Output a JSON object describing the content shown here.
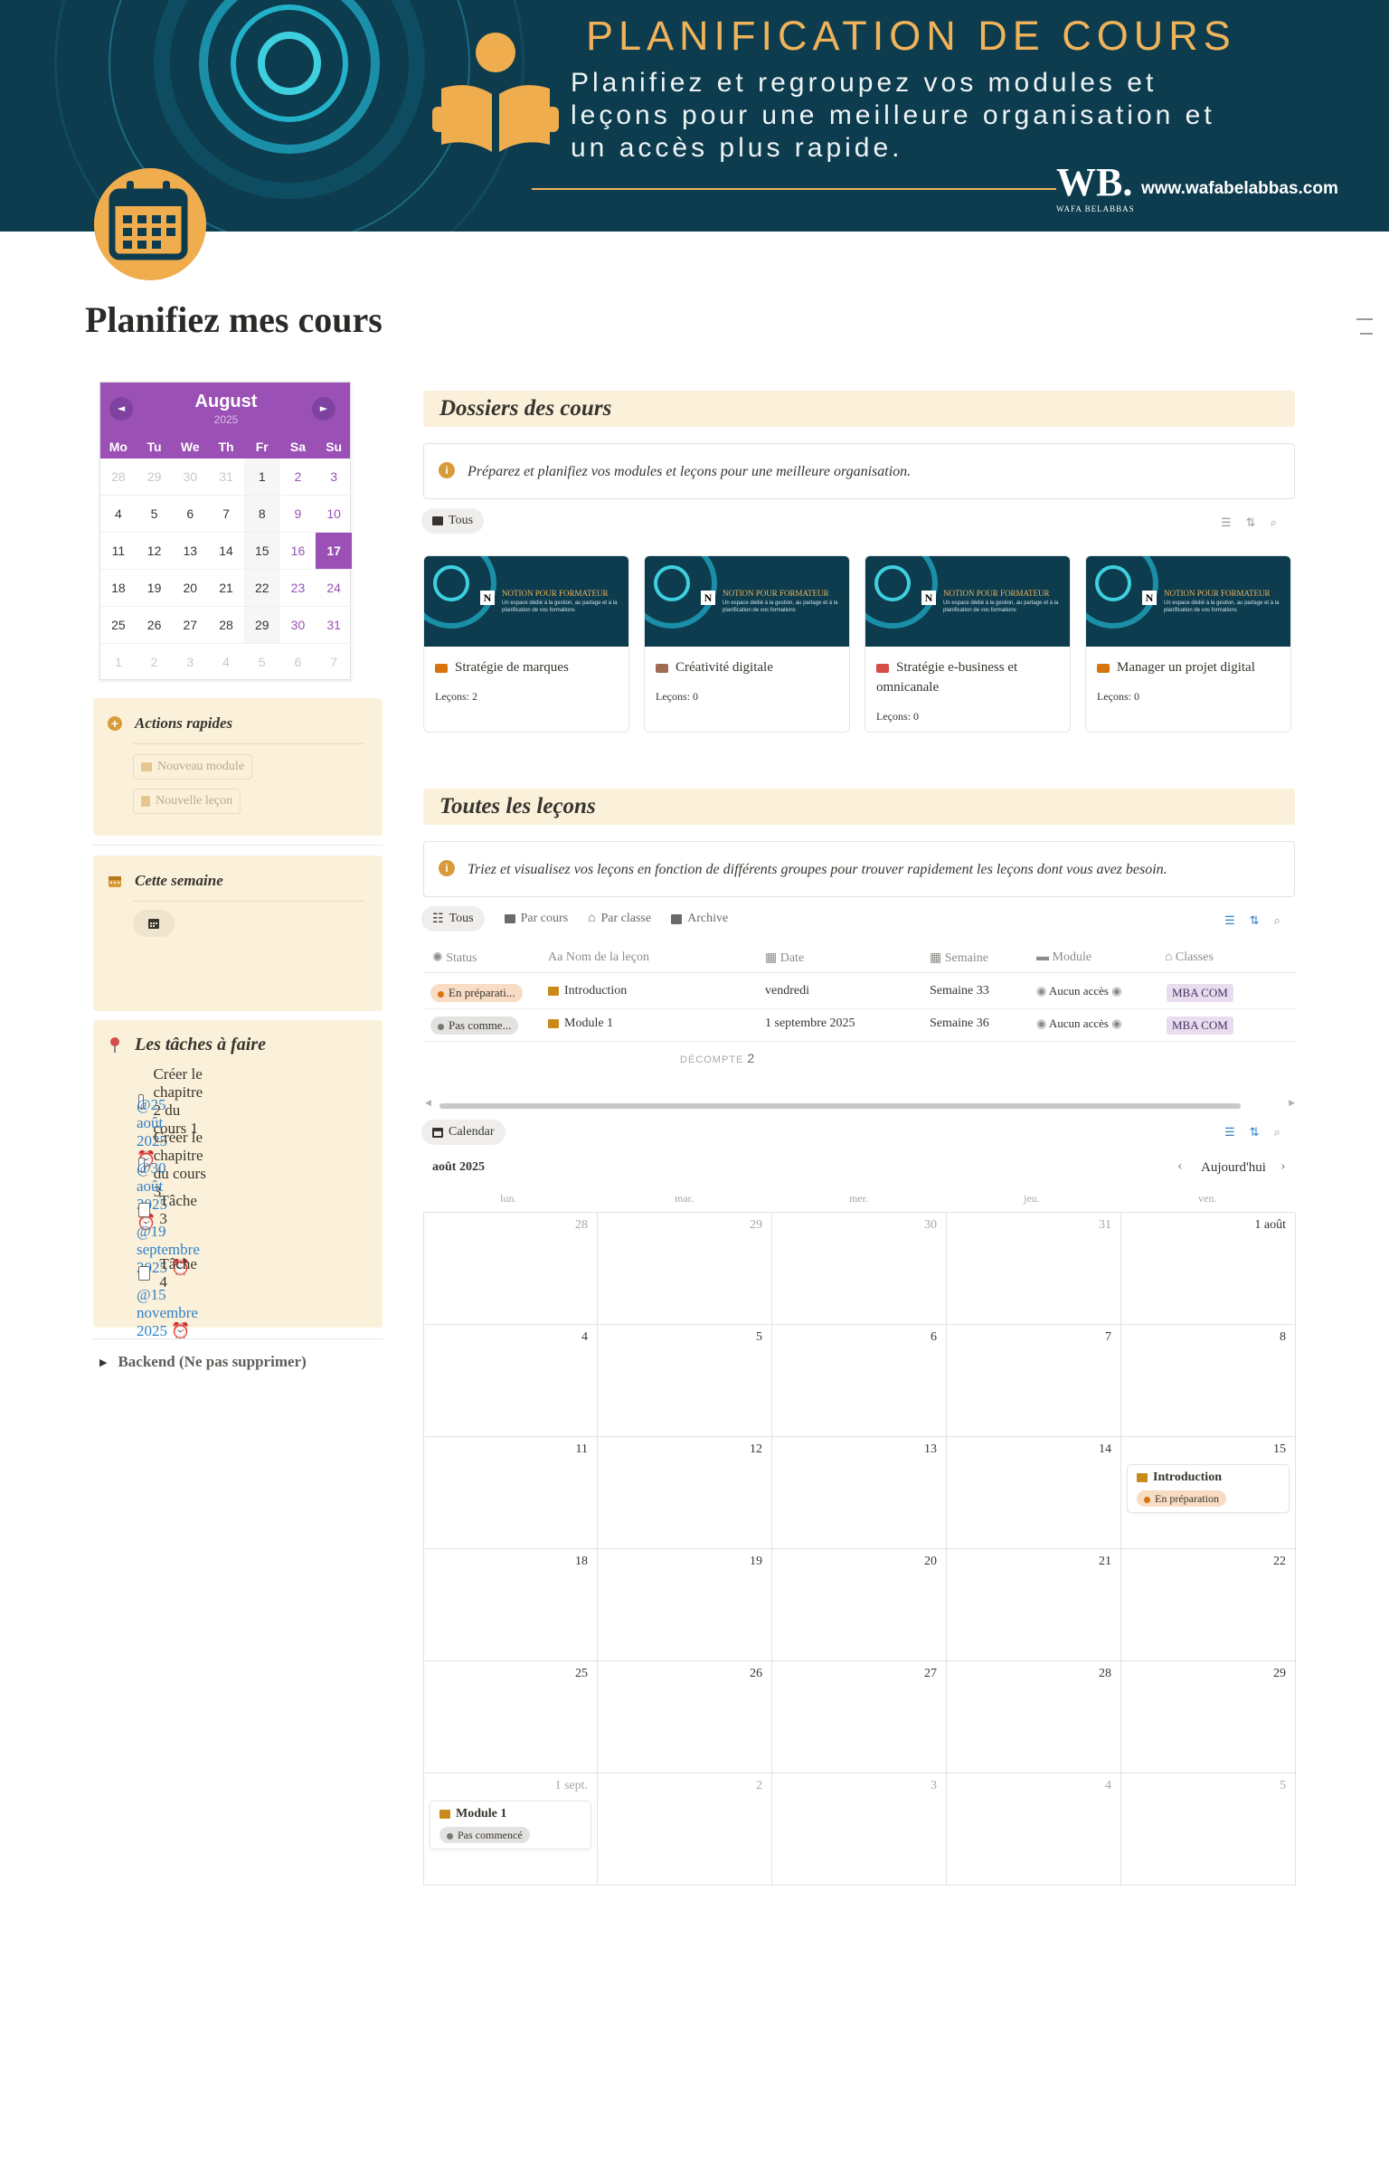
{
  "banner": {
    "title": "PLANIFICATION DE COURS",
    "subtitle": "Planifiez et regroupez vos modules et leçons pour une meilleure organisation et un accès plus rapide.",
    "logo_text": "WB.",
    "logo_caption": "WAFA BELABBAS",
    "url": "www.wafabelabbas.com"
  },
  "page": {
    "title": "Planifiez mes cours"
  },
  "mini_calendar": {
    "month": "August",
    "year": "2025",
    "prev": "◄",
    "next": "►",
    "weekdays": [
      "Mo",
      "Tu",
      "We",
      "Th",
      "Fr",
      "Sa",
      "Su"
    ],
    "today": "17",
    "weeks": [
      [
        "28",
        "29",
        "30",
        "31",
        "1",
        "2",
        "3"
      ],
      [
        "4",
        "5",
        "6",
        "7",
        "8",
        "9",
        "10"
      ],
      [
        "11",
        "12",
        "13",
        "14",
        "15",
        "16",
        "17"
      ],
      [
        "18",
        "19",
        "20",
        "21",
        "22",
        "23",
        "24"
      ],
      [
        "25",
        "26",
        "27",
        "28",
        "29",
        "30",
        "31"
      ],
      [
        "1",
        "2",
        "3",
        "4",
        "5",
        "6",
        "7"
      ]
    ]
  },
  "quick_actions": {
    "title": "Actions rapides",
    "new_module": "Nouveau module",
    "new_lesson": "Nouvelle leçon"
  },
  "this_week": {
    "title": "Cette semaine"
  },
  "todos": {
    "title": "Les tâches à faire",
    "items": [
      {
        "label": "Créer le chapitre 2 du cours 1",
        "due": "@25 août 2025"
      },
      {
        "label": "Créer le chapitre du cours 3",
        "due": "@30 août 2025"
      },
      {
        "label": "Tâche 3",
        "due": "@19 septembre 2025"
      },
      {
        "label": "Tâche 4",
        "due": "@15 novembre 2025"
      }
    ]
  },
  "backend": {
    "label": "Backend (Ne pas supprimer)"
  },
  "folders": {
    "title": "Dossiers des cours",
    "callout": "Préparez et planifiez vos modules et leçons pour une meilleure organisation.",
    "view_label": "Tous",
    "cover_title": "NOTION POUR FORMATEUR",
    "cover_sub": "Un espace dédié à la gestion, au partage et à la planification de vos formations",
    "cards": [
      {
        "title": "Stratégie de marques",
        "count": "Leçons: 2",
        "color": "#d9730d"
      },
      {
        "title": "Créativité digitale",
        "count": "Leçons: 0",
        "color": "#9f6b53"
      },
      {
        "title": "Stratégie e-business et omnicanale",
        "count": "Leçons: 0",
        "color": "#d44c47"
      },
      {
        "title": "Manager un projet digital",
        "count": "Leçons: 0",
        "color": "#d9730d"
      }
    ]
  },
  "lessons": {
    "title": "Toutes les leçons",
    "callout": "Triez et visualisez vos leçons en fonction de différents groupes pour trouver rapidement les leçons dont vous avez besoin.",
    "tabs": [
      "Tous",
      "Par cours",
      "Par classe",
      "Archive"
    ],
    "columns": [
      "Status",
      "Nom de la leçon",
      "Date",
      "Semaine",
      "Module",
      "Classes"
    ],
    "rows": [
      {
        "status": "En préparati...",
        "name": "Introduction",
        "date": "vendredi",
        "week": "Semaine 33",
        "module": "Aucun accès",
        "class": "MBA COM"
      },
      {
        "status": "Pas comme...",
        "name": "Module 1",
        "date": "1 septembre 2025",
        "week": "Semaine 36",
        "module": "Aucun accès",
        "class": "MBA COM"
      }
    ],
    "count_label": "DÉCOMPTE",
    "count_value": "2"
  },
  "calendar": {
    "view_label": "Calendar",
    "month": "août 2025",
    "today": "Aujourd'hui",
    "weekdays": [
      "lun.",
      "mar.",
      "mer.",
      "jeu.",
      "ven."
    ],
    "weeks": [
      [
        "28",
        "29",
        "30",
        "31",
        "1 août"
      ],
      [
        "4",
        "5",
        "6",
        "7",
        "8"
      ],
      [
        "11",
        "12",
        "13",
        "14",
        "15"
      ],
      [
        "18",
        "19",
        "20",
        "21",
        "22"
      ],
      [
        "25",
        "26",
        "27",
        "28",
        "29"
      ],
      [
        "1 sept.",
        "2",
        "3",
        "4",
        "5"
      ]
    ],
    "events": [
      {
        "title": "Introduction",
        "status": "En préparation"
      },
      {
        "title": "Module 1",
        "status": "Pas commencé"
      }
    ]
  },
  "colors": {
    "accent": "#9a50b5",
    "banner": "#0c3c4e",
    "gold": "#f0b35a",
    "panel": "#fbf1da"
  }
}
